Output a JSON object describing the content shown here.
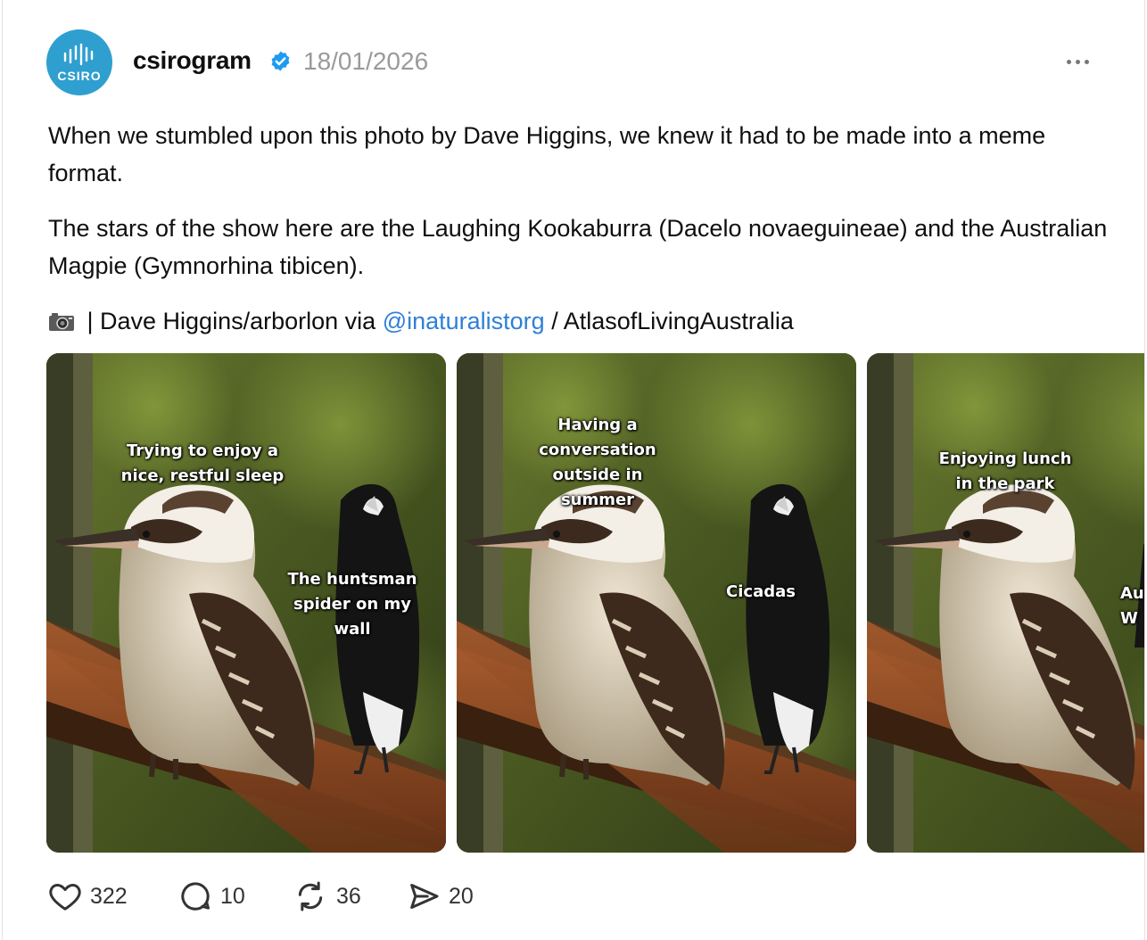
{
  "post": {
    "username": "csirogram",
    "verified": true,
    "date": "18/01/2026",
    "avatar_text": "CSIRO",
    "more_icon": "more-horizontal-icon",
    "paragraph1": "When we stumbled upon this photo by Dave Higgins, we knew it had to be made into a meme format.",
    "paragraph2": "The stars of the show here are the Laughing Kookaburra (Dacelo novaeguineae) and the Australian Magpie (Gymnorhina tibicen).",
    "credit": {
      "icon": "camera-icon",
      "prefix": " | Dave Higgins/arborlon via ",
      "link": "@inaturalistorg",
      "suffix": " / AtlasofLivingAustralia"
    }
  },
  "slides": [
    {
      "kookaburra_caption": "Trying to enjoy a\nnice, restful sleep",
      "magpie_caption": "The huntsman\nspider on my\nwall"
    },
    {
      "kookaburra_caption": "Having a\nconversation\noutside in\nsummer",
      "magpie_caption": "Cicadas"
    },
    {
      "kookaburra_caption": "Enjoying lunch\nin the park",
      "magpie_caption": "Au\nW"
    }
  ],
  "actions": {
    "likes": "322",
    "replies": "10",
    "reposts": "36",
    "shares": "20"
  },
  "colors": {
    "avatar_bg": "#2f9fd0",
    "verified": "#1d9bf0",
    "link": "#2f7fd8",
    "muted": "#9a9a9a"
  }
}
